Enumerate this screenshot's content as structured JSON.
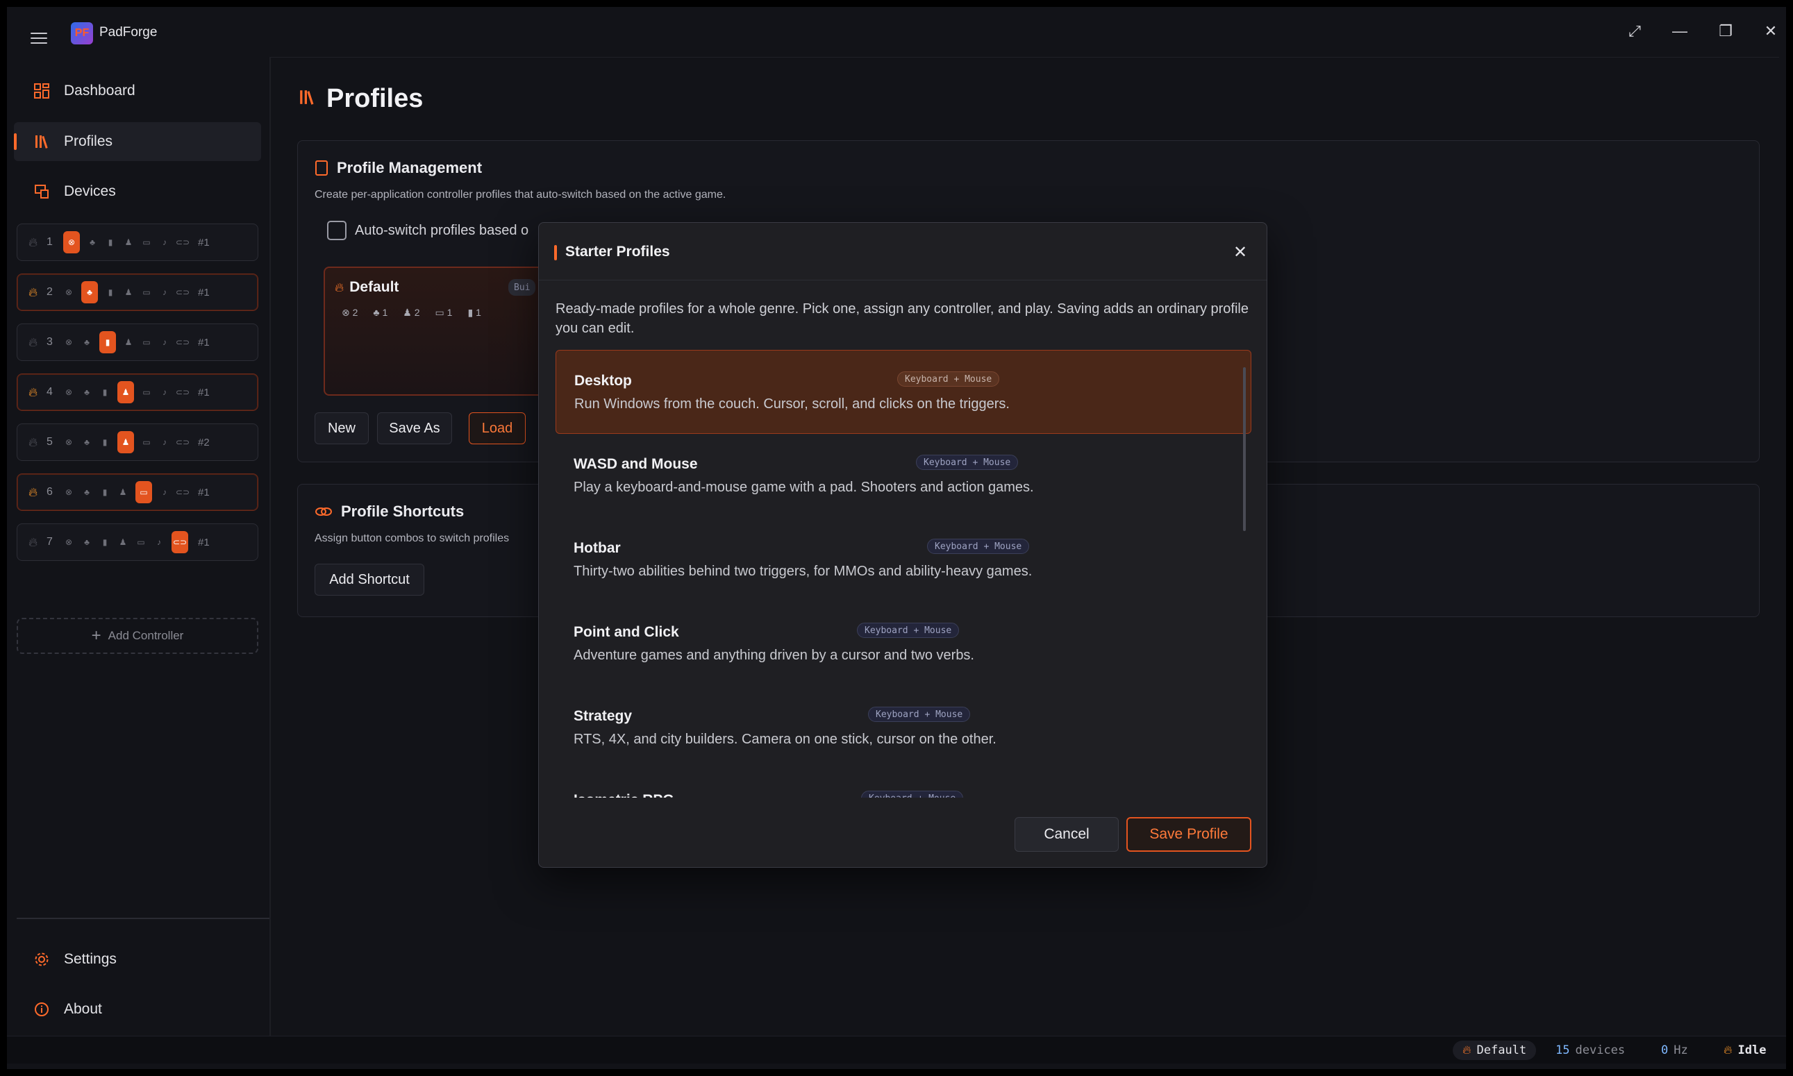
{
  "app": {
    "title": "PadForge",
    "logo_text": "PF"
  },
  "window_controls": {
    "expand": "⤢",
    "minimize": "—",
    "restore": "❐",
    "close": "✕"
  },
  "nav": {
    "dashboard": "Dashboard",
    "profiles": "Profiles",
    "devices": "Devices",
    "settings": "Settings",
    "about": "About",
    "add_controller": "Add Controller"
  },
  "slots": [
    {
      "num": "1",
      "active": false,
      "selected_icon": 0,
      "index": "#1"
    },
    {
      "num": "2",
      "active": true,
      "selected_icon": 1,
      "index": "#1"
    },
    {
      "num": "3",
      "active": false,
      "selected_icon": 2,
      "index": "#1"
    },
    {
      "num": "4",
      "active": true,
      "selected_icon": 3,
      "index": "#1"
    },
    {
      "num": "5",
      "active": false,
      "selected_icon": 3,
      "index": "#2"
    },
    {
      "num": "6",
      "active": true,
      "selected_icon": 4,
      "index": "#1"
    },
    {
      "num": "7",
      "active": false,
      "selected_icon": 6,
      "index": "#1"
    }
  ],
  "page": {
    "title": "Profiles",
    "management": {
      "title": "Profile Management",
      "subtitle": "Create per-application controller profiles that auto-switch based on the active game.",
      "auto_switch_label": "Auto-switch profiles based o",
      "default_profile": {
        "name": "Default",
        "badge": "Bui",
        "counts": [
          "2",
          "1",
          "2",
          "1",
          "1"
        ]
      },
      "buttons": {
        "new": "New",
        "save_as": "Save As",
        "load": "Load"
      }
    },
    "shortcuts": {
      "title": "Profile Shortcuts",
      "subtitle": "Assign button combos to switch profiles",
      "add_button": "Add Shortcut"
    }
  },
  "modal": {
    "title": "Starter Profiles",
    "intro": "Ready-made profiles for a whole genre. Pick one, assign any controller, and play. Saving adds an ordinary profile you can edit.",
    "items": [
      {
        "name": "Desktop",
        "tag": "Keyboard + Mouse",
        "desc": "Run Windows from the couch. Cursor, scroll, and clicks on the triggers.",
        "selected": true
      },
      {
        "name": "WASD and Mouse",
        "tag": "Keyboard + Mouse",
        "desc": "Play a keyboard-and-mouse game with a pad. Shooters and action games.",
        "selected": false
      },
      {
        "name": "Hotbar",
        "tag": "Keyboard + Mouse",
        "desc": "Thirty-two abilities behind two triggers, for MMOs and ability-heavy games.",
        "selected": false
      },
      {
        "name": "Point and Click",
        "tag": "Keyboard + Mouse",
        "desc": "Adventure games and anything driven by a cursor and two verbs.",
        "selected": false
      },
      {
        "name": "Strategy",
        "tag": "Keyboard + Mouse",
        "desc": "RTS, 4X, and city builders. Camera on one stick, cursor on the other.",
        "selected": false
      },
      {
        "name": "Isometric RPG",
        "tag": "Keyboard + Mouse",
        "desc": "",
        "selected": false
      }
    ],
    "cancel": "Cancel",
    "save": "Save Profile"
  },
  "status": {
    "profile": "Default",
    "devices_count": "15",
    "devices_label": "devices",
    "hz_value": "0",
    "hz_label": "Hz",
    "state": "Idle"
  },
  "colors": {
    "accent": "#ff6a2b",
    "background": "#121318",
    "modal_bg": "#1f1f23",
    "selected_bg": "#4a2718"
  }
}
